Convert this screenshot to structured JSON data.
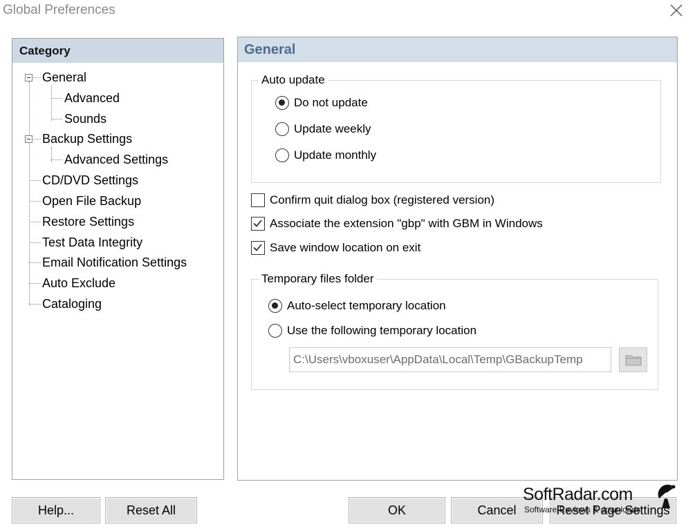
{
  "window": {
    "title": "Global Preferences"
  },
  "category": {
    "header": "Category",
    "items": [
      {
        "label": "General"
      },
      {
        "label": "Advanced"
      },
      {
        "label": "Sounds"
      },
      {
        "label": "Backup Settings"
      },
      {
        "label": "Advanced Settings"
      },
      {
        "label": "CD/DVD Settings"
      },
      {
        "label": "Open File Backup"
      },
      {
        "label": "Restore Settings"
      },
      {
        "label": "Test Data Integrity"
      },
      {
        "label": "Email Notification Settings"
      },
      {
        "label": "Auto Exclude"
      },
      {
        "label": "Cataloging"
      }
    ]
  },
  "general": {
    "header": "General",
    "auto_update": {
      "title": "Auto update",
      "options": [
        {
          "label": "Do not update",
          "selected": true
        },
        {
          "label": "Update weekly",
          "selected": false
        },
        {
          "label": "Update monthly",
          "selected": false
        }
      ]
    },
    "checks": [
      {
        "label": "Confirm quit dialog box (registered version)",
        "checked": false
      },
      {
        "label": "Associate the extension \"gbp\" with GBM in Windows",
        "checked": true
      },
      {
        "label": "Save window location on exit",
        "checked": true
      }
    ],
    "temp_folder": {
      "title": "Temporary files folder",
      "options": [
        {
          "label": "Auto-select temporary location",
          "selected": true
        },
        {
          "label": "Use the following temporary location",
          "selected": false
        }
      ],
      "path": "C:\\Users\\vboxuser\\AppData\\Local\\Temp\\GBackupTemp"
    }
  },
  "buttons": {
    "help": "Help...",
    "reset_all": "Reset All",
    "ok": "OK",
    "cancel": "Cancel",
    "reset_page": "Reset Page Settings"
  },
  "watermark": {
    "title": "SoftRadar.com",
    "subtitle": "Software Reviews & downloads"
  },
  "icons": {
    "close": "close-icon",
    "folder": "folder-icon",
    "tree_toggle": "minus-box-icon",
    "checkmark": "checkmark-icon",
    "satellite": "satellite-dish-icon"
  },
  "colors": {
    "category_header_bg": "#cdd8e4",
    "general_header_bg": "#d3dee8",
    "general_header_text": "#4d6b8c",
    "button_bg": "#e1e1e1"
  }
}
